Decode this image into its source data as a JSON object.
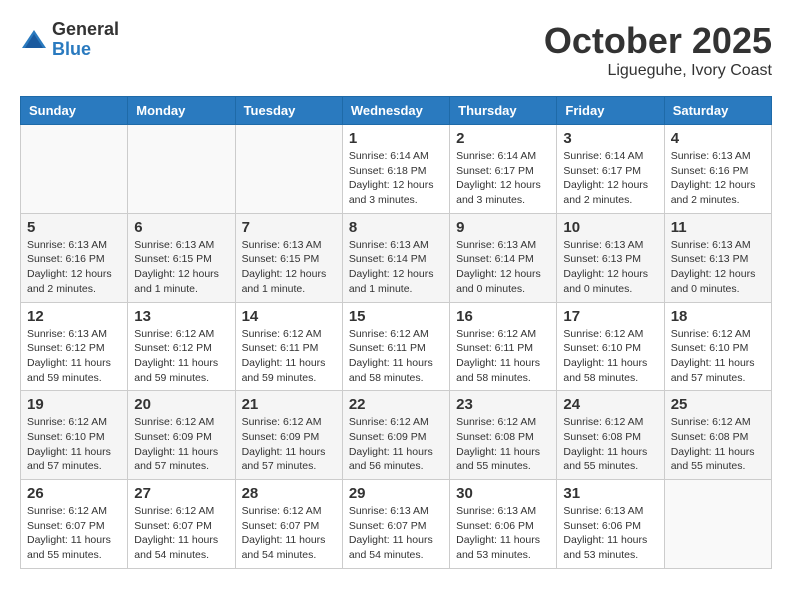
{
  "header": {
    "logo_general": "General",
    "logo_blue": "Blue",
    "month_title": "October 2025",
    "location": "Ligueguhe, Ivory Coast"
  },
  "weekdays": [
    "Sunday",
    "Monday",
    "Tuesday",
    "Wednesday",
    "Thursday",
    "Friday",
    "Saturday"
  ],
  "weeks": [
    [
      {
        "date": "",
        "info": ""
      },
      {
        "date": "",
        "info": ""
      },
      {
        "date": "",
        "info": ""
      },
      {
        "date": "1",
        "info": "Sunrise: 6:14 AM\nSunset: 6:18 PM\nDaylight: 12 hours and 3 minutes."
      },
      {
        "date": "2",
        "info": "Sunrise: 6:14 AM\nSunset: 6:17 PM\nDaylight: 12 hours and 3 minutes."
      },
      {
        "date": "3",
        "info": "Sunrise: 6:14 AM\nSunset: 6:17 PM\nDaylight: 12 hours and 2 minutes."
      },
      {
        "date": "4",
        "info": "Sunrise: 6:13 AM\nSunset: 6:16 PM\nDaylight: 12 hours and 2 minutes."
      }
    ],
    [
      {
        "date": "5",
        "info": "Sunrise: 6:13 AM\nSunset: 6:16 PM\nDaylight: 12 hours and 2 minutes."
      },
      {
        "date": "6",
        "info": "Sunrise: 6:13 AM\nSunset: 6:15 PM\nDaylight: 12 hours and 1 minute."
      },
      {
        "date": "7",
        "info": "Sunrise: 6:13 AM\nSunset: 6:15 PM\nDaylight: 12 hours and 1 minute."
      },
      {
        "date": "8",
        "info": "Sunrise: 6:13 AM\nSunset: 6:14 PM\nDaylight: 12 hours and 1 minute."
      },
      {
        "date": "9",
        "info": "Sunrise: 6:13 AM\nSunset: 6:14 PM\nDaylight: 12 hours and 0 minutes."
      },
      {
        "date": "10",
        "info": "Sunrise: 6:13 AM\nSunset: 6:13 PM\nDaylight: 12 hours and 0 minutes."
      },
      {
        "date": "11",
        "info": "Sunrise: 6:13 AM\nSunset: 6:13 PM\nDaylight: 12 hours and 0 minutes."
      }
    ],
    [
      {
        "date": "12",
        "info": "Sunrise: 6:13 AM\nSunset: 6:12 PM\nDaylight: 11 hours and 59 minutes."
      },
      {
        "date": "13",
        "info": "Sunrise: 6:12 AM\nSunset: 6:12 PM\nDaylight: 11 hours and 59 minutes."
      },
      {
        "date": "14",
        "info": "Sunrise: 6:12 AM\nSunset: 6:11 PM\nDaylight: 11 hours and 59 minutes."
      },
      {
        "date": "15",
        "info": "Sunrise: 6:12 AM\nSunset: 6:11 PM\nDaylight: 11 hours and 58 minutes."
      },
      {
        "date": "16",
        "info": "Sunrise: 6:12 AM\nSunset: 6:11 PM\nDaylight: 11 hours and 58 minutes."
      },
      {
        "date": "17",
        "info": "Sunrise: 6:12 AM\nSunset: 6:10 PM\nDaylight: 11 hours and 58 minutes."
      },
      {
        "date": "18",
        "info": "Sunrise: 6:12 AM\nSunset: 6:10 PM\nDaylight: 11 hours and 57 minutes."
      }
    ],
    [
      {
        "date": "19",
        "info": "Sunrise: 6:12 AM\nSunset: 6:10 PM\nDaylight: 11 hours and 57 minutes."
      },
      {
        "date": "20",
        "info": "Sunrise: 6:12 AM\nSunset: 6:09 PM\nDaylight: 11 hours and 57 minutes."
      },
      {
        "date": "21",
        "info": "Sunrise: 6:12 AM\nSunset: 6:09 PM\nDaylight: 11 hours and 57 minutes."
      },
      {
        "date": "22",
        "info": "Sunrise: 6:12 AM\nSunset: 6:09 PM\nDaylight: 11 hours and 56 minutes."
      },
      {
        "date": "23",
        "info": "Sunrise: 6:12 AM\nSunset: 6:08 PM\nDaylight: 11 hours and 55 minutes."
      },
      {
        "date": "24",
        "info": "Sunrise: 6:12 AM\nSunset: 6:08 PM\nDaylight: 11 hours and 55 minutes."
      },
      {
        "date": "25",
        "info": "Sunrise: 6:12 AM\nSunset: 6:08 PM\nDaylight: 11 hours and 55 minutes."
      }
    ],
    [
      {
        "date": "26",
        "info": "Sunrise: 6:12 AM\nSunset: 6:07 PM\nDaylight: 11 hours and 55 minutes."
      },
      {
        "date": "27",
        "info": "Sunrise: 6:12 AM\nSunset: 6:07 PM\nDaylight: 11 hours and 54 minutes."
      },
      {
        "date": "28",
        "info": "Sunrise: 6:12 AM\nSunset: 6:07 PM\nDaylight: 11 hours and 54 minutes."
      },
      {
        "date": "29",
        "info": "Sunrise: 6:13 AM\nSunset: 6:07 PM\nDaylight: 11 hours and 54 minutes."
      },
      {
        "date": "30",
        "info": "Sunrise: 6:13 AM\nSunset: 6:06 PM\nDaylight: 11 hours and 53 minutes."
      },
      {
        "date": "31",
        "info": "Sunrise: 6:13 AM\nSunset: 6:06 PM\nDaylight: 11 hours and 53 minutes."
      },
      {
        "date": "",
        "info": ""
      }
    ]
  ]
}
